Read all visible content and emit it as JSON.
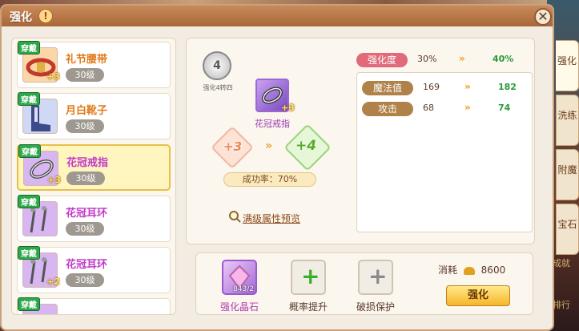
{
  "title": "强化",
  "help_icon": "!",
  "close_icon": "✕",
  "items": [
    {
      "badge": "穿戴",
      "name": "礼节腰带",
      "level": "30级",
      "plus": "+3",
      "name_color": "#e07a1a",
      "icon_bg": "#fbd6a8"
    },
    {
      "badge": "穿戴",
      "name": "月白靴子",
      "level": "30级",
      "plus": "",
      "name_color": "#e07a1a",
      "icon_bg": "#cfd8f4"
    },
    {
      "badge": "穿戴",
      "name": "花冠戒指",
      "level": "30级",
      "plus": "+3",
      "name_color": "#c03ac8",
      "icon_bg": "#d7b6f2"
    },
    {
      "badge": "穿戴",
      "name": "花冠耳环",
      "level": "30级",
      "plus": "",
      "name_color": "#c03ac8",
      "icon_bg": "#d7b6f2"
    },
    {
      "badge": "穿戴",
      "name": "花冠耳环",
      "level": "30级",
      "plus": "+2",
      "name_color": "#c03ac8",
      "icon_bg": "#d7b6f2"
    },
    {
      "badge": "穿戴",
      "name": "",
      "level": "",
      "plus": "",
      "name_color": "#c03ac8",
      "icon_bg": "#d7b6f2"
    }
  ],
  "main": {
    "gauge_num": "4",
    "gauge_sub": "强化4转四",
    "item_name": "花冠戒指",
    "item_plus": "+3",
    "from_level": "+3",
    "to_level": "+4",
    "success_rate": "成功率：70%",
    "preview": "满级属性预览"
  },
  "stats": [
    {
      "label": "强化度",
      "current": "30%",
      "next": "40%",
      "color": "#e06a7a"
    },
    {
      "label": "魔法值",
      "current": "169",
      "next": "182",
      "color": "#b0824a"
    },
    {
      "label": "攻击",
      "current": "68",
      "next": "74",
      "color": "#b0824a"
    }
  ],
  "bottom": {
    "crystal_label": "强化晶石",
    "crystal_count": "843/2",
    "rate_label": "概率提升",
    "protect_label": "破损保护",
    "consume_label": "消耗",
    "consume_amount": "8600",
    "button": "强化"
  },
  "tabs": [
    "强化",
    "洗练",
    "附魔",
    "宝石"
  ],
  "side": [
    "成就",
    "排行"
  ]
}
